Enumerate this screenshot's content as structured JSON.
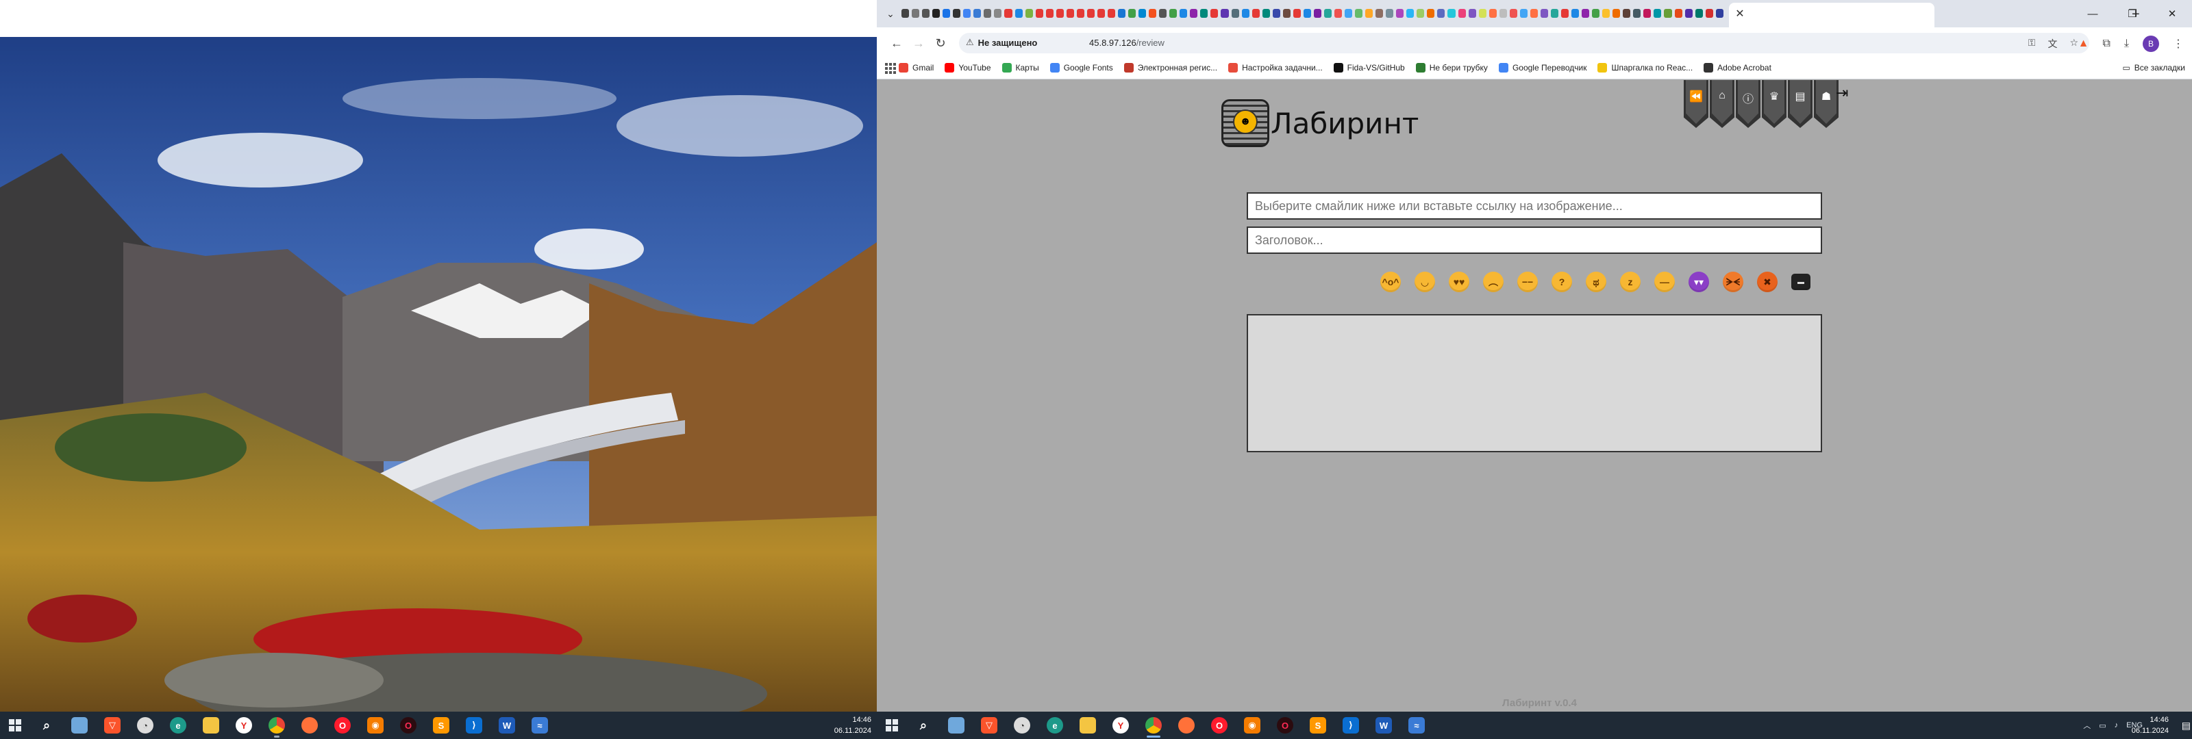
{
  "browser": {
    "tab_close_symbol": "✕",
    "new_tab_symbol": "+",
    "window_controls": [
      "—",
      "❐",
      "✕"
    ],
    "security_label": "Не защищено",
    "url_host": "45.8.97.126",
    "url_path": "/review",
    "profile_initial": "B",
    "bookmarks": [
      {
        "label": "Gmail",
        "color": "#ea4335"
      },
      {
        "label": "YouTube",
        "color": "#ff0000"
      },
      {
        "label": "Карты",
        "color": "#34a853"
      },
      {
        "label": "Google Fonts",
        "color": "#4285f4"
      },
      {
        "label": "Электронная регис...",
        "color": "#c0392b"
      },
      {
        "label": "Настройка задачни...",
        "color": "#e74c3c"
      },
      {
        "label": "Fida-VS/GitHub",
        "color": "#111111"
      },
      {
        "label": "Не бери трубку",
        "color": "#2e7d32"
      },
      {
        "label": "Google Переводчик",
        "color": "#4285f4"
      },
      {
        "label": "Шпаргалка по Reac...",
        "color": "#f1c40f"
      },
      {
        "label": "Adobe Acrobat",
        "color": "#333333"
      }
    ],
    "all_bookmarks_label": "Все закладки"
  },
  "page": {
    "logo_title": "Лабиринт",
    "nav_icons": [
      "rewind-icon",
      "home-icon",
      "info-icon",
      "trophy-icon",
      "document-icon",
      "users-icon"
    ],
    "image_input_placeholder": "Выберите смайлик ниже или вставьте ссылку на изображение...",
    "title_input_placeholder": "Заголовок...",
    "emojis": [
      {
        "name": "party-emoji-icon",
        "glyph": "^o^"
      },
      {
        "name": "smile-emoji-icon",
        "glyph": "◡"
      },
      {
        "name": "heart-eyes-emoji-icon",
        "glyph": "♥♥"
      },
      {
        "name": "sad-emoji-icon",
        "glyph": "︵"
      },
      {
        "name": "unamused-emoji-icon",
        "glyph": "−−"
      },
      {
        "name": "thinking-emoji-icon",
        "glyph": "?"
      },
      {
        "name": "crying-emoji-icon",
        "glyph": "ಥ"
      },
      {
        "name": "sleepy-emoji-icon",
        "glyph": "z"
      },
      {
        "name": "neutral-emoji-icon",
        "glyph": "—"
      },
      {
        "name": "devil-emoji-icon",
        "glyph": "▾▾"
      },
      {
        "name": "angry-emoji-icon",
        "glyph": "ᗒᗕ"
      },
      {
        "name": "rage-emoji-icon",
        "glyph": "✖"
      },
      {
        "name": "card-emoji-icon",
        "glyph": "▬"
      }
    ],
    "version": "Лабиринт v.0.4"
  },
  "taskbar_left": {
    "time": "14:46",
    "date": "06.11.2024"
  },
  "taskbar_right": {
    "language": "ENG",
    "time": "14:46",
    "date": "06.11.2024"
  }
}
